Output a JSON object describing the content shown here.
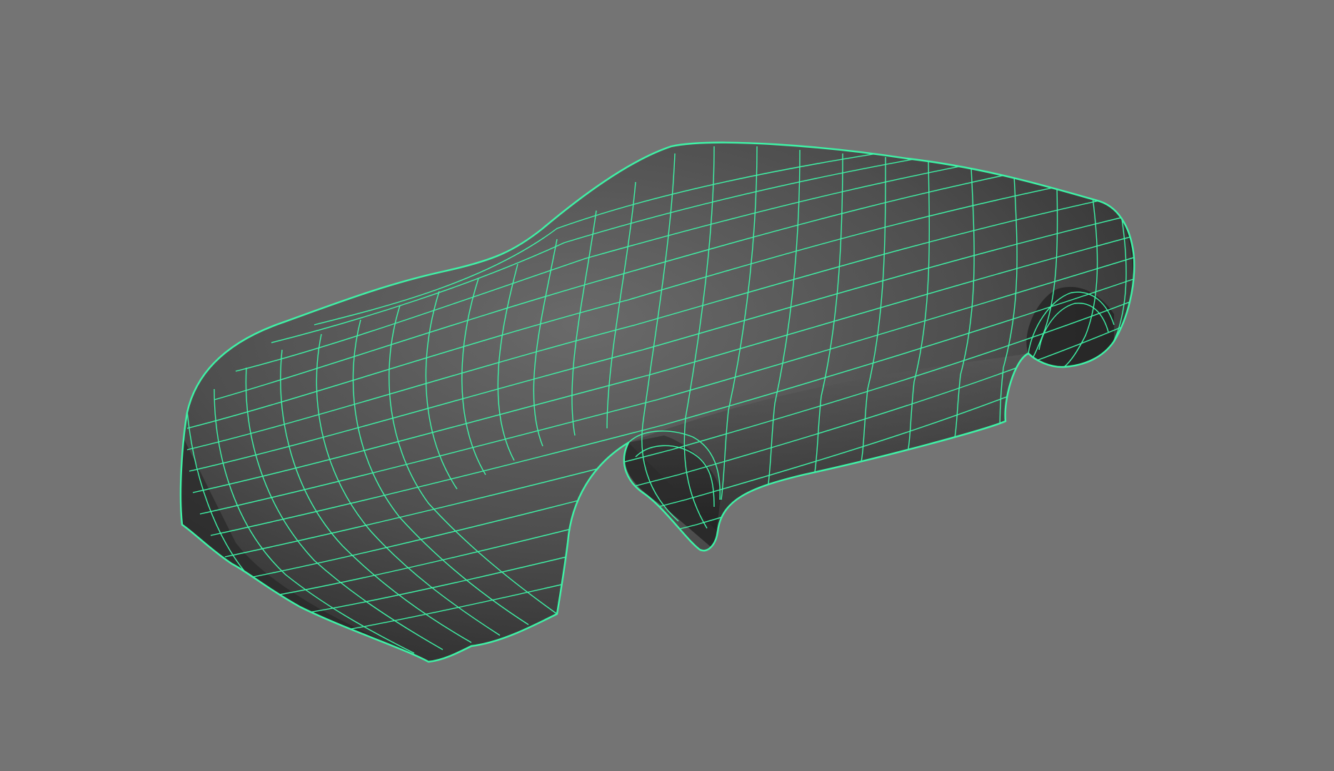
{
  "viewport": {
    "background": "#747474",
    "shaded_mode": "smooth-shade-with-wireframe-on-shaded",
    "selection_color": "#3ff2a6",
    "mesh_color_dark": "#2a2a2a",
    "mesh_color_light": "#6a6a6a"
  },
  "mesh": {
    "object": "car-body",
    "selected": true
  }
}
